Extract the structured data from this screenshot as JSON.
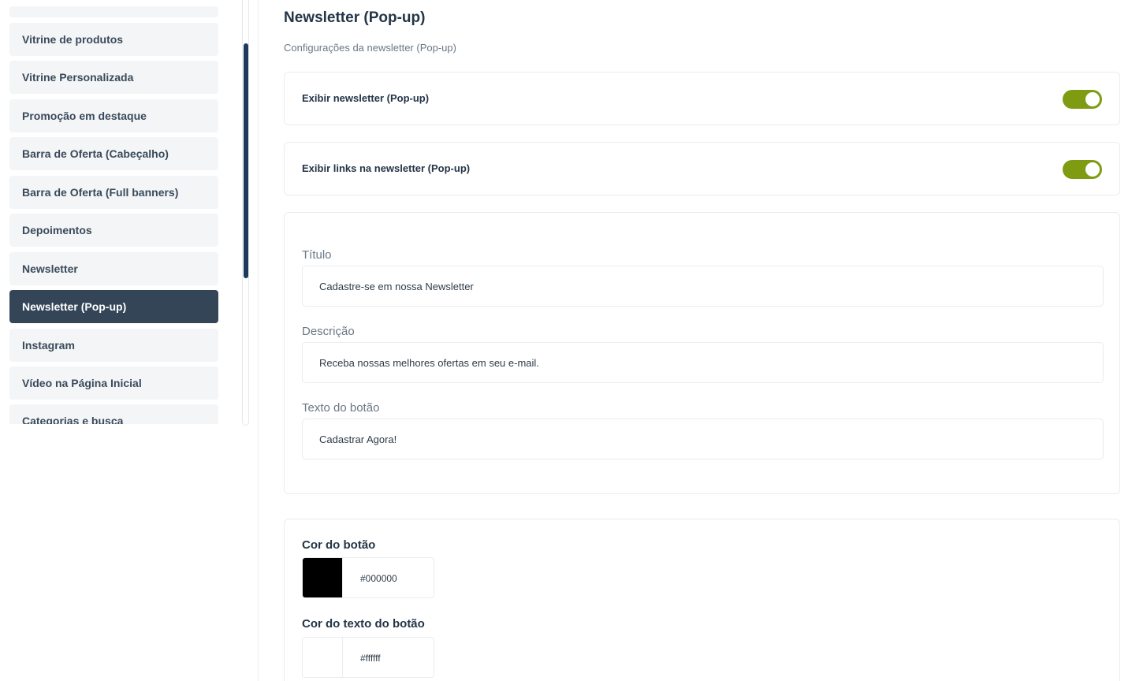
{
  "sidebar": {
    "items": [
      {
        "label": "Vitrine de produtos"
      },
      {
        "label": "Vitrine Personalizada"
      },
      {
        "label": "Promoção em destaque"
      },
      {
        "label": "Barra de Oferta (Cabeçalho)"
      },
      {
        "label": "Barra de Oferta (Full banners)"
      },
      {
        "label": "Depoimentos"
      },
      {
        "label": "Newsletter"
      },
      {
        "label": "Newsletter (Pop-up)",
        "active": true
      },
      {
        "label": "Instagram"
      },
      {
        "label": "Vídeo na Página Inicial"
      },
      {
        "label": "Categorias e busca"
      }
    ]
  },
  "main": {
    "title": "Newsletter (Pop-up)",
    "subtitle": "Configurações da newsletter (Pop-up)",
    "toggles": [
      {
        "label": "Exibir newsletter (Pop-up)",
        "on": true
      },
      {
        "label": "Exibir links na newsletter (Pop-up)",
        "on": true
      }
    ],
    "fields": {
      "titulo": {
        "label": "Título",
        "value": "Cadastre-se em nossa Newsletter"
      },
      "descricao": {
        "label": "Descrição",
        "value": "Receba nossas melhores ofertas em seu e-mail."
      },
      "texto_botao": {
        "label": "Texto do botão",
        "value": "Cadastrar Agora!"
      }
    },
    "colors": {
      "cor_botao": {
        "label": "Cor do botão",
        "hex": "#000000"
      },
      "cor_texto_botao": {
        "label": "Cor do texto do botão",
        "hex": "#ffffff"
      }
    }
  },
  "theme": {
    "accent_toggle": "#7f9b12",
    "sidebar_active": "#344558",
    "scrollbar": "#1d3a5c"
  }
}
